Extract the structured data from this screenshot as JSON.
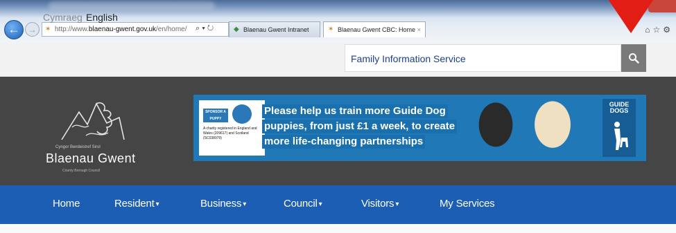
{
  "browser": {
    "address": {
      "url_prefix": "http://www.",
      "url_domain": "blaenau-gwent.gov.uk",
      "url_path": "/en/home/"
    },
    "tabs": [
      {
        "label": "Blaenau Gwent Intranet"
      },
      {
        "label": "Blaenau Gwent CBC: Home"
      }
    ],
    "tab_close_glyph": "×",
    "address_controls": "⌕ ▾ ↻"
  },
  "header": {
    "lang_welsh": "Cymraeg",
    "lang_english": "English",
    "search_value": "Family Information Service"
  },
  "logo": {
    "welsh_name": "Cyngor Bwrdeistref Sirol",
    "title": "Blaenau Gwent",
    "subtitle": "County Borough Council"
  },
  "ad": {
    "sponsor": "SPONSOR A PUPPY",
    "small_print": "A charity registered in England and Wales (209617) and Scotland (SC038979)",
    "line1": "Please help us train more Guide Dog",
    "line2": "puppies, from just £1 a week, to create",
    "line3": "more life-changing partnerships",
    "brand": "GUIDE DOGS"
  },
  "nav": {
    "items": [
      {
        "label": "Home",
        "dropdown": false
      },
      {
        "label": "Resident",
        "dropdown": true
      },
      {
        "label": "Business",
        "dropdown": true
      },
      {
        "label": "Council",
        "dropdown": true
      },
      {
        "label": "Visitors",
        "dropdown": true
      },
      {
        "label": "My Services",
        "dropdown": false
      }
    ]
  },
  "colors": {
    "nav_bg": "#1c5eb3",
    "banner_bg": "#454545",
    "annotation_arrow": "#e21e14"
  }
}
